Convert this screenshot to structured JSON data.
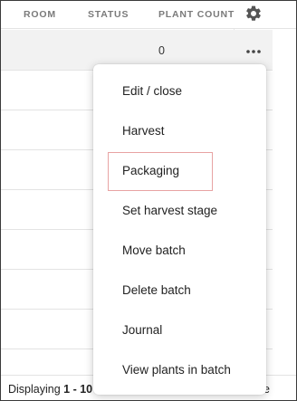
{
  "header": {
    "columns": [
      "ROOM",
      "STATUS",
      "PLANT COUNT"
    ]
  },
  "rows": [
    {
      "plant_count": "0",
      "selected": true
    }
  ],
  "menu": {
    "items": [
      {
        "label": "Edit / close"
      },
      {
        "label": "Harvest"
      },
      {
        "label": "Packaging",
        "focused": true
      },
      {
        "label": "Set harvest stage"
      },
      {
        "label": "Move batch"
      },
      {
        "label": "Delete batch"
      },
      {
        "label": "Journal"
      },
      {
        "label": "View plants in batch"
      }
    ]
  },
  "footer": {
    "prefix": "Displaying ",
    "range": "1 - 10",
    "suffix": "e"
  },
  "icons": {
    "settings": "gear-icon",
    "row_actions": "more-horizontal-icon"
  },
  "colors": {
    "focus_outline": "#e8a3a3",
    "selected_row": "#f2f2f2"
  }
}
